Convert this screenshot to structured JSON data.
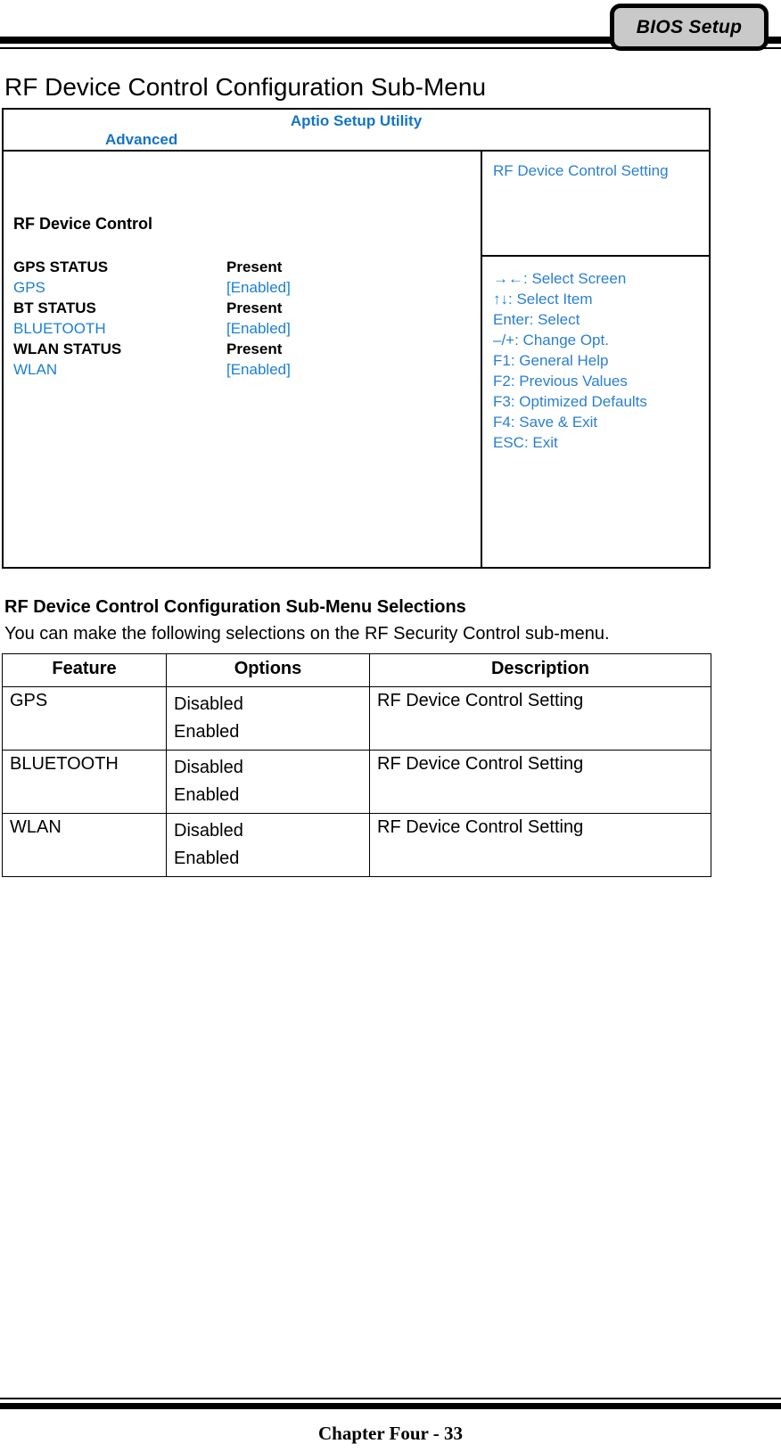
{
  "header": {
    "tab_label": "BIOS Setup"
  },
  "page_title": "RF Device Control Configuration Sub-Menu",
  "bios_screen": {
    "utility_title": "Aptio Setup Utility",
    "menu_tab": "Advanced",
    "section_title": "RF Device Control",
    "items": [
      {
        "label": "GPS STATUS",
        "value": "Present",
        "kind": "status"
      },
      {
        "label": "GPS",
        "value": "[Enabled]",
        "kind": "option"
      },
      {
        "label": "BT STATUS",
        "value": "Present",
        "kind": "status"
      },
      {
        "label": "BLUETOOTH",
        "value": "[Enabled]",
        "kind": "option"
      },
      {
        "label": "WLAN STATUS",
        "value": "Present",
        "kind": "status"
      },
      {
        "label": "WLAN",
        "value": "[Enabled]",
        "kind": "option"
      }
    ],
    "help_description": "RF Device Control Setting",
    "key_legend": [
      "→←: Select Screen",
      "↑↓: Select Item",
      "Enter: Select",
      "–/+: Change Opt.",
      "F1: General Help",
      "F2: Previous Values",
      "F3: Optimized Defaults",
      "F4: Save & Exit",
      "ESC: Exit"
    ],
    "colors": {
      "title_blue": "#1474c4",
      "option_blue": "#1a7fd4",
      "help_blue": "#2a7fd0"
    }
  },
  "selections": {
    "heading": "RF Device Control Configuration Sub-Menu Selections",
    "intro": "You can make the following selections on the RF Security Control sub-menu.",
    "columns": [
      "Feature",
      "Options",
      "Description"
    ],
    "rows": [
      {
        "feature": "GPS",
        "options": [
          "Disabled",
          "Enabled"
        ],
        "description": "RF Device Control Setting"
      },
      {
        "feature": "BLUETOOTH",
        "options": [
          "Disabled",
          "Enabled"
        ],
        "description": "RF Device Control Setting"
      },
      {
        "feature": "WLAN",
        "options": [
          "Disabled",
          "Enabled"
        ],
        "description": "RF Device Control Setting"
      }
    ]
  },
  "footer": {
    "text": "Chapter Four - 33"
  }
}
